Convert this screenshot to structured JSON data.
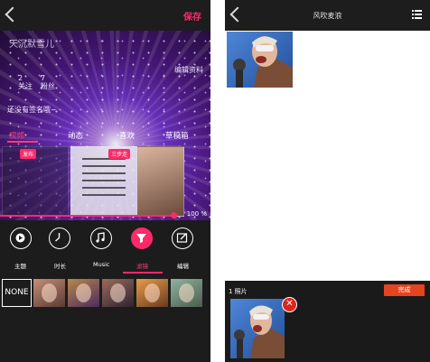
{
  "left_screen": {
    "save_label": "保存",
    "preview": {
      "profile_name": "天沉默雪儿",
      "stats": [
        {
          "count": "2",
          "label": "关注"
        },
        {
          "count": "7",
          "label": "粉丝"
        }
      ],
      "edit_profile": "编辑资料",
      "bio": "还没有签名哦~",
      "tabs": [
        "视频",
        "动态",
        "喜欢",
        "草稿箱"
      ],
      "badges": [
        "发布",
        "三步走"
      ],
      "progress_percent": 100,
      "progress_text": "100 %"
    },
    "tools": [
      {
        "label": "主题",
        "icon": "play-icon"
      },
      {
        "label": "时长",
        "icon": "clock-icon"
      },
      {
        "label": "Music",
        "icon": "music-note-icon"
      },
      {
        "label": "滤镜",
        "icon": "filter-icon"
      },
      {
        "label": "编辑",
        "icon": "edit-icon"
      }
    ],
    "active_tool": "滤镜",
    "filters": {
      "none_label": "NONE",
      "thumbnails": 5
    },
    "accent_color": "#ff2a6a"
  },
  "right_screen": {
    "title": "风吹麦浪",
    "selected_count": "1 照片",
    "done_label": "完成",
    "done_color": "#e4441f"
  }
}
